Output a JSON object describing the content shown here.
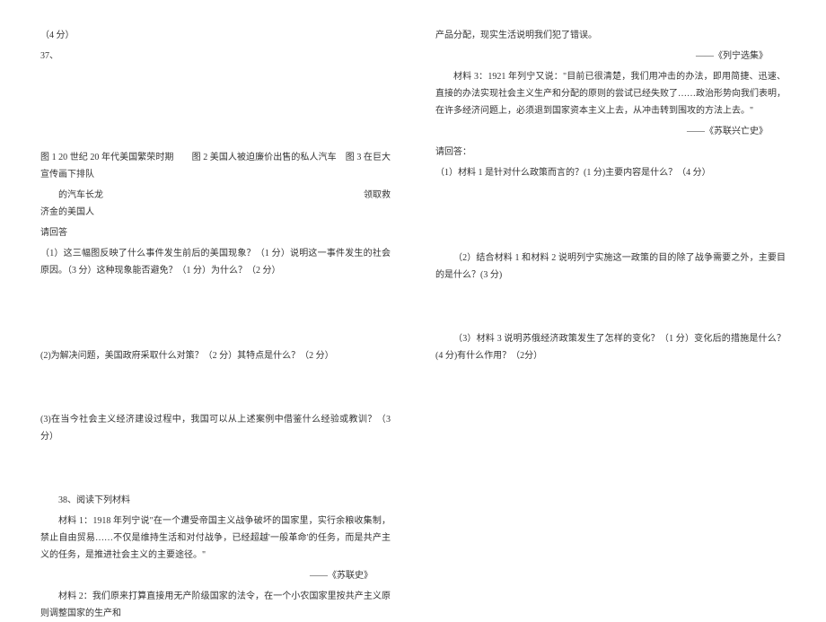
{
  "left": {
    "score_line": "（4 分）",
    "q37_num": "37、",
    "captions_line1": "图 1  20 世纪 20 年代美国繁荣时期　　图 2  美国人被迫廉价出售的私人汽车　图 3  在巨大宣传画下排队",
    "captions_line2": "　　的汽车长龙　　　　　　　　　　　　　　　　　　　　　　　　　　　　　领取救济金的美国人",
    "answer_label": "请回答",
    "q37_1": "（1）这三幅图反映了什么事件发生前后的美国现象？（1 分）说明这一事件发生的社会原因。（3 分）这种现象能否避免？（1 分）为什么？（2 分）",
    "q37_2": "(2)为解决问题，美国政府采取什么对策？（2 分）其特点是什么？（2 分）",
    "q37_3": "(3)在当今社会主义经济建设过程中，我国可以从上述案例中借鉴什么经验或教训？（3 分）",
    "q38_num": "38、阅读下列材料",
    "m1": "材料 1：1918 年列宁说\"在一个遭受帝国主义战争破坏的国家里，实行余粮收集制，禁止自由贸易……不仅是维持生活和对付战争，已经超越'一般革命'的任务，而是共产主义的任务，是推进社会主义的主要途径。\"",
    "m1_src": "——《苏联史》",
    "m2": "材料 2：我们原来打算直接用无产阶级国家的法令，在一个小农国家里按共产主义原则调整国家的生产和"
  },
  "right": {
    "m2_cont": "产品分配，现实生活说明我们犯了错误。",
    "m2_src": "——《列宁选集》",
    "m3": "材料 3：1921 年列宁又说：\"目前已很清楚，我们用冲击的办法，即用简捷、迅速、直接的办法实现社会主义生产和分配的原则的尝试已经失败了……政治形势向我们表明，在许多经济问题上，必须退到国家资本主义上去，从冲击转到围攻的方法上去。\"",
    "m3_src": "——《苏联兴亡史》",
    "answer_label": "请回答：",
    "r1": "（1）材料 1 是针对什么政策而言的？(1 分)主要内容是什么？（4 分）",
    "r2": "（2）结合材料 1 和材料 2 说明列宁实施这一政策的目的除了战争需要之外，主要目的是什么？(3 分)",
    "r3": "（3）材料 3 说明苏俄经济政策发生了怎样的变化？（1 分）变化后的措施是什么？(4 分)有什么作用？（2分）"
  }
}
